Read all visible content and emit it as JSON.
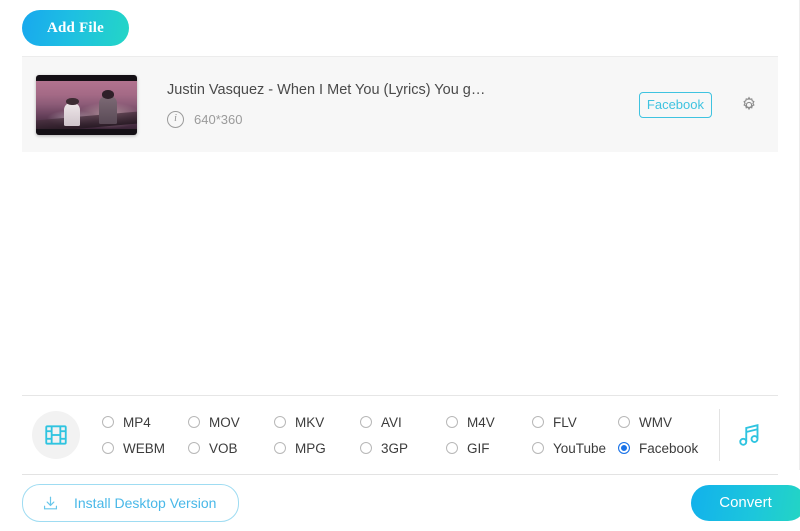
{
  "toolbar": {
    "add_file_label": "Add File"
  },
  "file_item": {
    "title": "Justin Vasquez - When I Met You (Lyrics) You g…",
    "resolution": "640*360",
    "info_glyph": "i",
    "target_format_badge": "Facebook",
    "settings_icon": "gear-icon",
    "thumbnail_alt": "video-thumbnail"
  },
  "format_bar": {
    "video_toggle_icon": "film-strip-icon",
    "audio_toggle_icon": "music-note-icon",
    "selected": "Facebook",
    "options": [
      {
        "label": "MP4",
        "selected": false
      },
      {
        "label": "MOV",
        "selected": false
      },
      {
        "label": "MKV",
        "selected": false
      },
      {
        "label": "AVI",
        "selected": false
      },
      {
        "label": "M4V",
        "selected": false
      },
      {
        "label": "FLV",
        "selected": false
      },
      {
        "label": "WMV",
        "selected": false
      },
      {
        "label": "WEBM",
        "selected": false
      },
      {
        "label": "VOB",
        "selected": false
      },
      {
        "label": "MPG",
        "selected": false
      },
      {
        "label": "3GP",
        "selected": false
      },
      {
        "label": "GIF",
        "selected": false
      },
      {
        "label": "YouTube",
        "selected": false
      },
      {
        "label": "Facebook",
        "selected": true
      }
    ]
  },
  "footer": {
    "install_label": "Install Desktop Version",
    "install_icon": "download-icon",
    "convert_label": "Convert"
  },
  "colors": {
    "accent_cyan": "#3fc3e0",
    "accent_blue": "#12b1ec",
    "accent_teal": "#24d6c2",
    "radio_selected_blue": "#1a73e8",
    "card_bg": "#f7f7f7"
  }
}
